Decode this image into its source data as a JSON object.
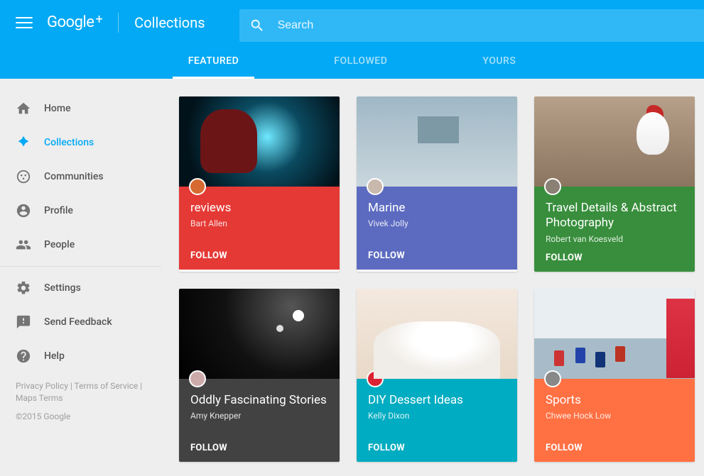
{
  "header": {
    "logo": "Google",
    "logo_plus": "+",
    "page_title": "Collections",
    "search_placeholder": "Search"
  },
  "tabs": {
    "featured": "FEATURED",
    "followed": "FOLLOWED",
    "yours": "YOURS"
  },
  "sidebar": {
    "home": "Home",
    "collections": "Collections",
    "communities": "Communities",
    "profile": "Profile",
    "people": "People",
    "settings": "Settings",
    "send_feedback": "Send Feedback",
    "help": "Help",
    "privacy": "Privacy Policy",
    "tos": "Terms of Service",
    "maps": "Maps Terms",
    "sep": " | ",
    "copyright": "©2015 Google"
  },
  "cards": [
    {
      "title": "reviews",
      "author": "Bart Allen",
      "follow": "FOLLOW",
      "color": "#E53935",
      "avatar": "#d66a30"
    },
    {
      "title": "Marine",
      "author": "Vivek Jolly",
      "follow": "FOLLOW",
      "color": "#5C6BC0",
      "avatar": "#c9b9ad"
    },
    {
      "title": "Travel Details & Abstract Photography",
      "author": "Robert van Koesveld",
      "follow": "FOLLOW",
      "color": "#388E3C",
      "avatar": "#8a8074"
    },
    {
      "title": "Oddly Fascinating Stories",
      "author": "Amy Knepper",
      "follow": "FOLLOW",
      "color": "#424242",
      "avatar": "#caa"
    },
    {
      "title": "DIY Dessert Ideas",
      "author": "Kelly Dixon",
      "follow": "FOLLOW",
      "color": "#00ACC1",
      "avatar": "#d23"
    },
    {
      "title": "Sports",
      "author": "Chwee Hock Low",
      "follow": "FOLLOW",
      "color": "#FF7043",
      "avatar": "#888"
    }
  ]
}
